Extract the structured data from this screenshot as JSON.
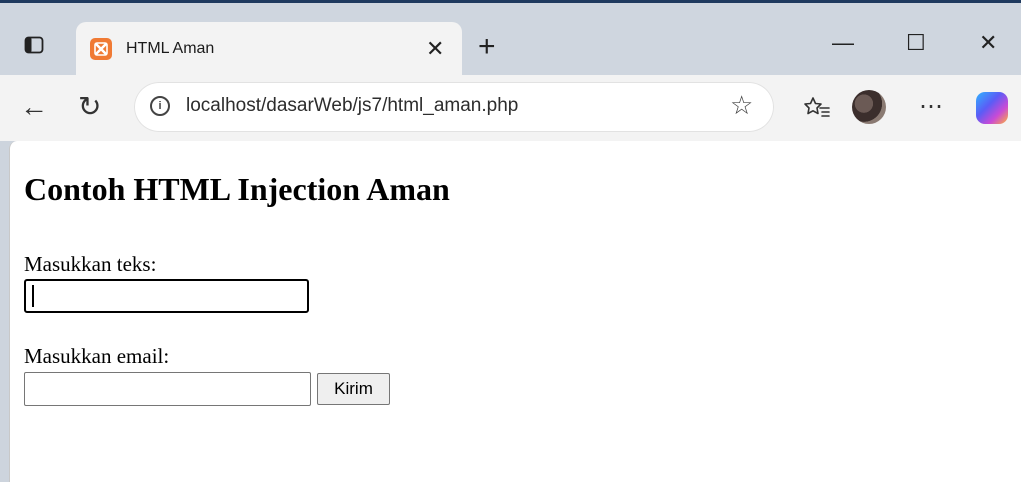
{
  "browser": {
    "tab": {
      "title": "HTML Aman",
      "close_glyph": "✕"
    },
    "new_tab_glyph": "+",
    "window_controls": {
      "minimize": "—",
      "maximize": "☐",
      "close": "✕"
    },
    "nav": {
      "back": "←",
      "reload": "↻",
      "more": "⋯"
    },
    "address_bar": {
      "url": "localhost/dasarWeb/js7/html_aman.php",
      "info_glyph": "i"
    },
    "icons": [
      "sidebar-icon",
      "xampp-favicon",
      "close-icon",
      "plus-icon",
      "info-icon",
      "star-icon",
      "favorites-icon",
      "profile-avatar",
      "more-icon",
      "copilot-icon"
    ]
  },
  "page": {
    "heading": "Contoh HTML Injection Aman",
    "form": {
      "text_label": "Masukkan teks:",
      "text_value": "",
      "email_label": "Masukkan email:",
      "email_value": "",
      "submit_label": "Kirim"
    }
  }
}
